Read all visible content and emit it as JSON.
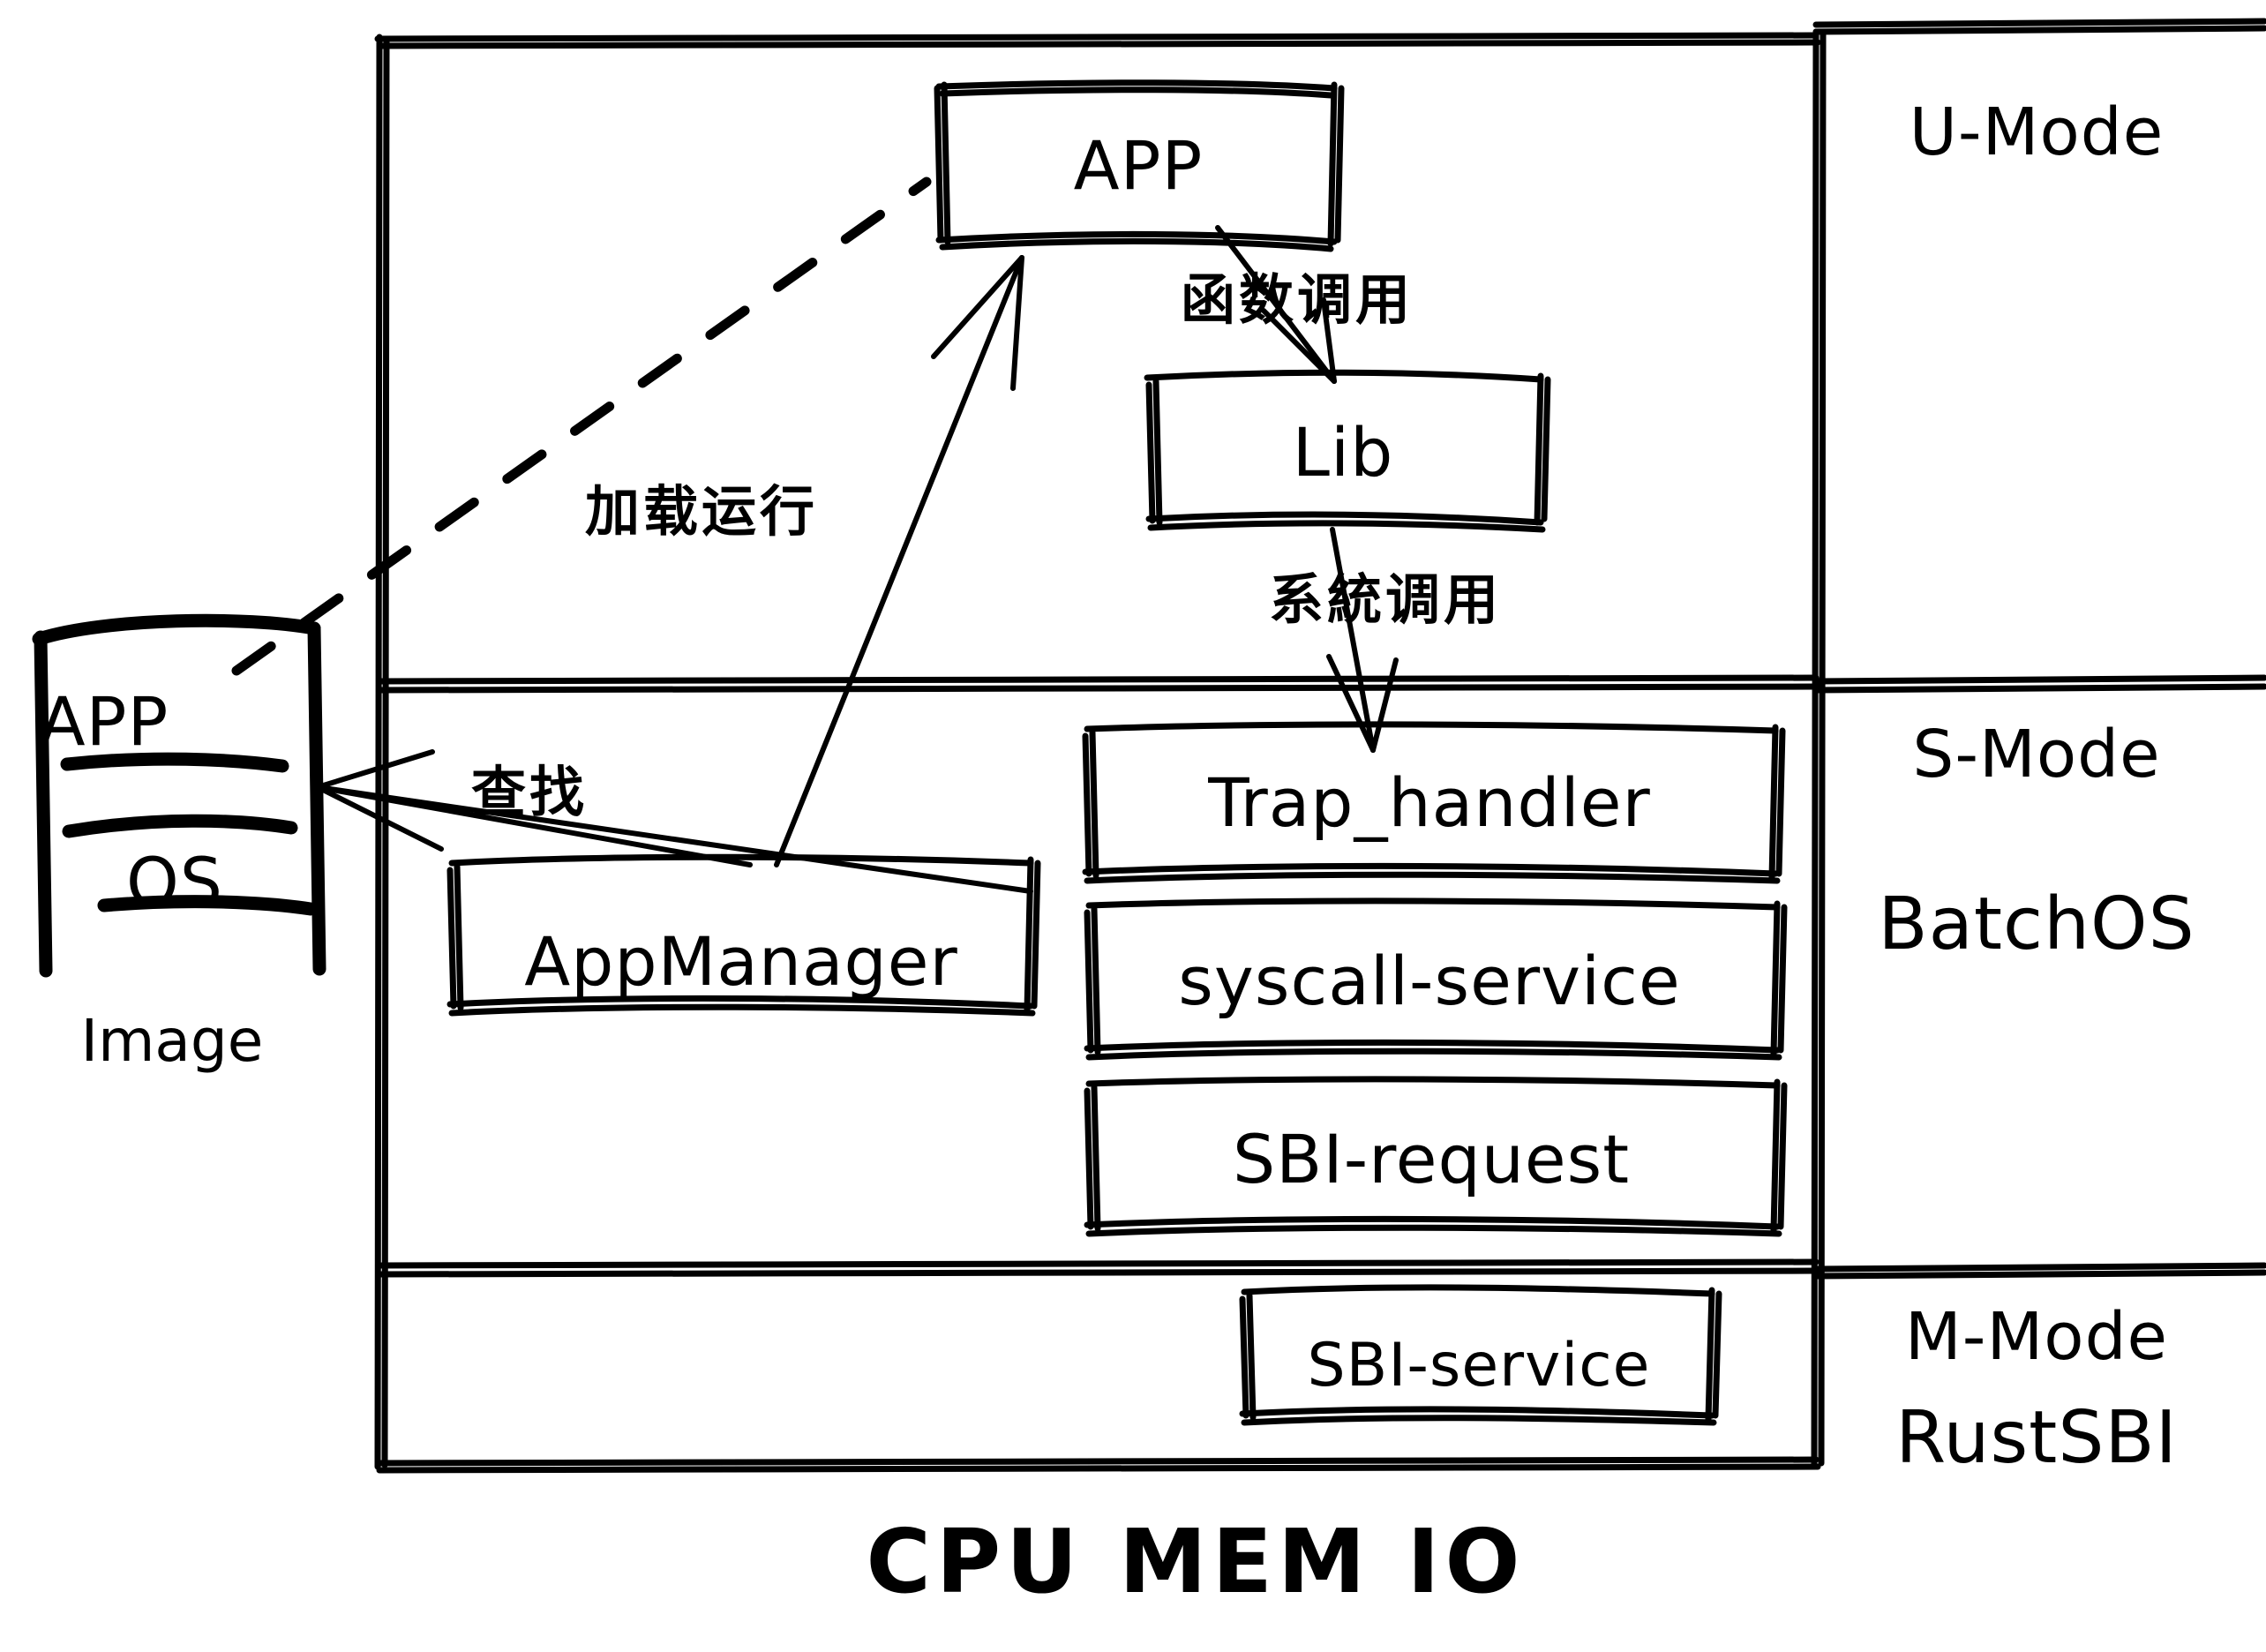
{
  "diagram": {
    "title": "BatchOS privilege-mode architecture",
    "stroke_color": "#000000",
    "background_color": "#ffffff"
  },
  "image_stack": {
    "app_label": "APP",
    "os_label": "OS",
    "caption": "Image"
  },
  "modes": [
    {
      "id": "u-mode",
      "label": "U-Mode",
      "sub_label": ""
    },
    {
      "id": "s-mode",
      "label": "S-Mode",
      "sub_label": "BatchOS"
    },
    {
      "id": "m-mode",
      "label": "M-Mode",
      "sub_label": "RustSBI"
    }
  ],
  "boxes": {
    "app": "APP",
    "lib": "Lib",
    "trap_handler": "Trap_handler",
    "syscall_service": "syscall-service",
    "sbi_request": "SBI-request",
    "app_manager": "AppManager",
    "sbi_service": "SBI-service"
  },
  "annotations": {
    "load_run": "加载运行",
    "function_call": "函数调用",
    "system_call": "系統调用",
    "lookup": "查找"
  },
  "hardware": {
    "label": "CPU  MEM  IO"
  }
}
